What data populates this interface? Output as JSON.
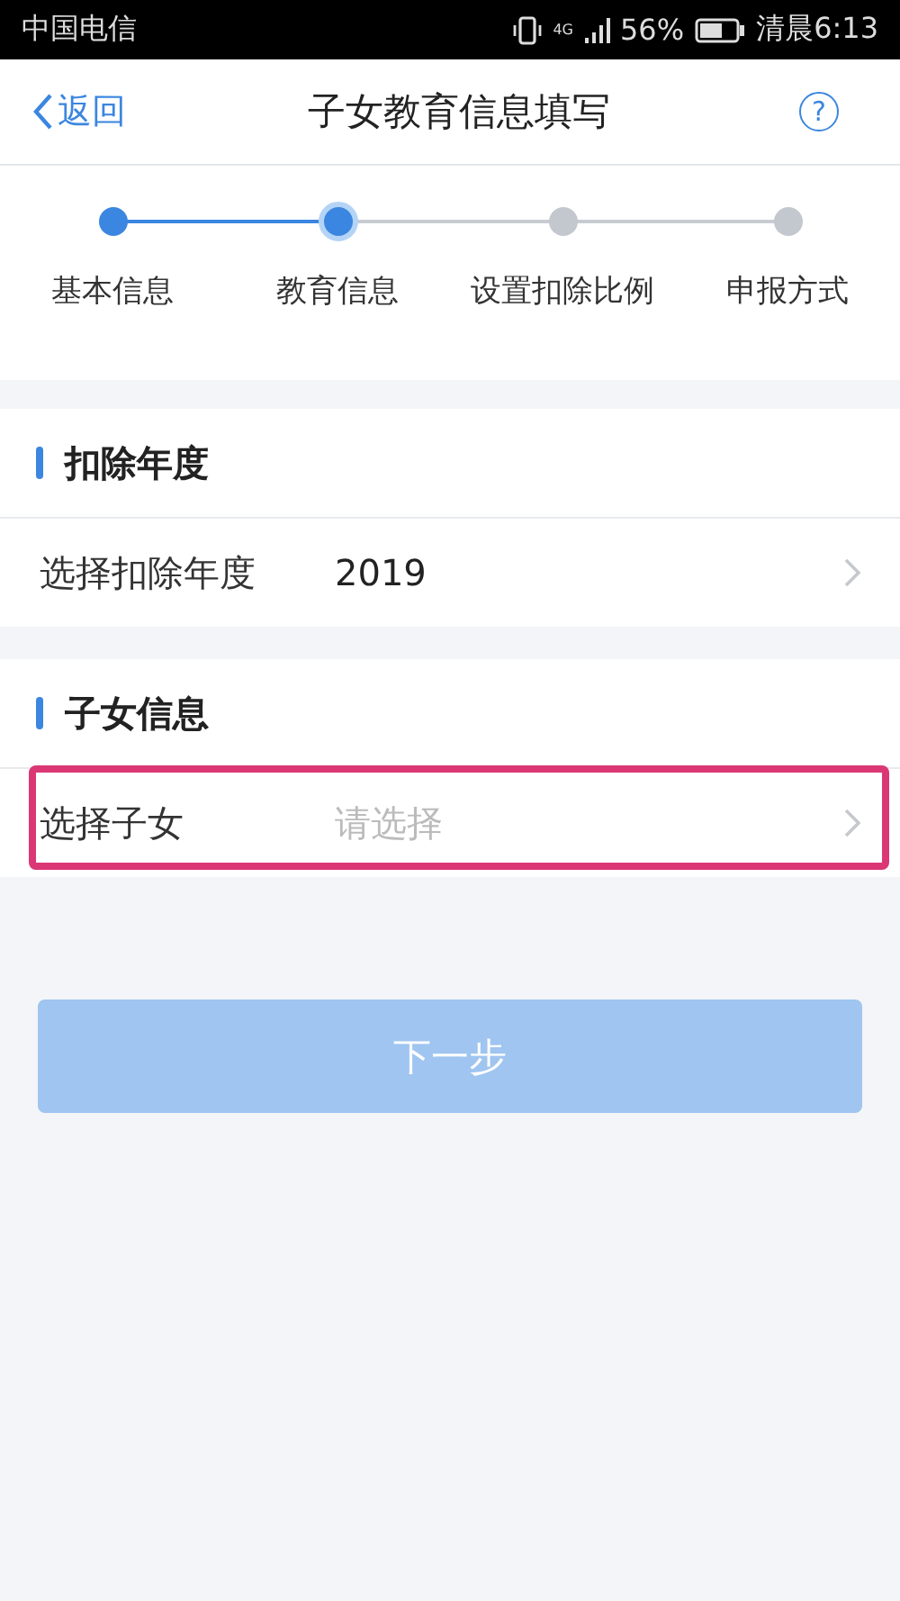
{
  "status_bar": {
    "carrier": "中国电信",
    "network": "4G",
    "battery": "56%",
    "time": "清晨6:13"
  },
  "nav": {
    "back": "返回",
    "title": "子女教育信息填写",
    "help": "?"
  },
  "steps": [
    {
      "label": "基本信息",
      "completed": true,
      "selected": false
    },
    {
      "label": "教育信息",
      "completed": false,
      "selected": true
    },
    {
      "label": "设置扣除比例",
      "completed": false,
      "selected": false
    },
    {
      "label": "申报方式",
      "completed": false,
      "selected": false
    }
  ],
  "sections": [
    {
      "title": "扣除年度",
      "rows": [
        {
          "label": "选择扣除年度",
          "value": "2019",
          "placeholder": null,
          "highlighted": false
        }
      ]
    },
    {
      "title": "子女信息",
      "rows": [
        {
          "label": "选择子女",
          "value": null,
          "placeholder": "请选择",
          "highlighted": true
        }
      ]
    }
  ],
  "next_button": {
    "label": "下一步",
    "disabled": true
  }
}
